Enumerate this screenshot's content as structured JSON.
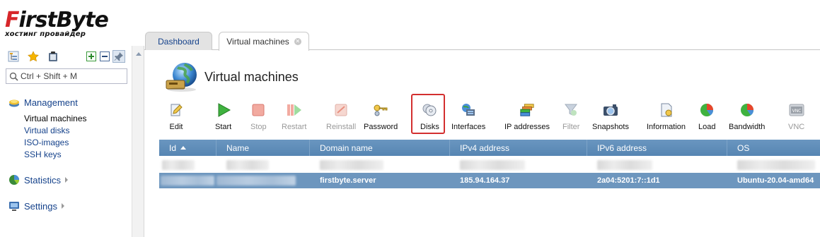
{
  "brand": {
    "logo_prefix": "F",
    "logo_main": "irstByte",
    "logo_tagline": "хостинг провайдер"
  },
  "left_panel": {
    "search": {
      "placeholder": "Ctrl + Shift + M",
      "value": ""
    },
    "sections": [
      {
        "label": "Management",
        "expanded": true,
        "items": [
          "Virtual machines",
          "Virtual disks",
          "ISO-images",
          "SSH keys"
        ],
        "active_item": "Virtual machines"
      },
      {
        "label": "Statistics",
        "expanded": false
      },
      {
        "label": "Settings",
        "expanded": false
      }
    ]
  },
  "tabs": [
    {
      "label": "Dashboard",
      "active": false
    },
    {
      "label": "Virtual machines",
      "active": true,
      "closable": true
    }
  ],
  "page": {
    "title": "Virtual machines"
  },
  "toolbar": [
    {
      "label": "Edit",
      "icon": "edit-icon",
      "enabled": true
    },
    {
      "label": "Start",
      "icon": "play-icon",
      "enabled": true
    },
    {
      "label": "Stop",
      "icon": "stop-icon",
      "enabled": false
    },
    {
      "label": "Restart",
      "icon": "restart-icon",
      "enabled": false
    },
    {
      "label": "Reinstall",
      "icon": "reinstall-icon",
      "enabled": false
    },
    {
      "label": "Password",
      "icon": "key-icon",
      "enabled": true
    },
    {
      "label": "Disks",
      "icon": "disk-icon",
      "enabled": true,
      "highlighted": true
    },
    {
      "label": "Interfaces",
      "icon": "network-interface-icon",
      "enabled": true
    },
    {
      "label": "IP addresses",
      "icon": "ip-addresses-icon",
      "enabled": true
    },
    {
      "label": "Filter",
      "icon": "filter-icon",
      "enabled": false
    },
    {
      "label": "Snapshots",
      "icon": "camera-icon",
      "enabled": true
    },
    {
      "label": "Information",
      "icon": "info-document-icon",
      "enabled": true
    },
    {
      "label": "Load",
      "icon": "pie-chart-icon",
      "enabled": true
    },
    {
      "label": "Bandwidth",
      "icon": "pie-chart-icon",
      "enabled": true
    },
    {
      "label": "VNC",
      "icon": "vnc-icon",
      "enabled": false
    }
  ],
  "grid": {
    "columns": [
      "Id",
      "Name",
      "Domain name",
      "IPv4 address",
      "IPv6 address",
      "OS"
    ],
    "sort_column": "Id",
    "sort_direction": "ascending",
    "rows": [
      {
        "id": "",
        "name": "",
        "domain": "",
        "ipv4": "",
        "ipv6": "",
        "os": "",
        "redacted": true,
        "selected": false
      },
      {
        "id": "",
        "name": "",
        "domain": "firstbyte.server",
        "ipv4": "185.94.164.37",
        "ipv6": "2a04:5201:7::1d1",
        "os": "Ubuntu-20.04-amd64",
        "redacted_cells": [
          "id",
          "name"
        ],
        "selected": true
      }
    ]
  },
  "colors": {
    "accent": "#15428b",
    "grid_header": "#5b8ab6",
    "selected_row": "#6d96be",
    "highlight_border": "#d32f2f",
    "brand_red": "#d7262a"
  }
}
